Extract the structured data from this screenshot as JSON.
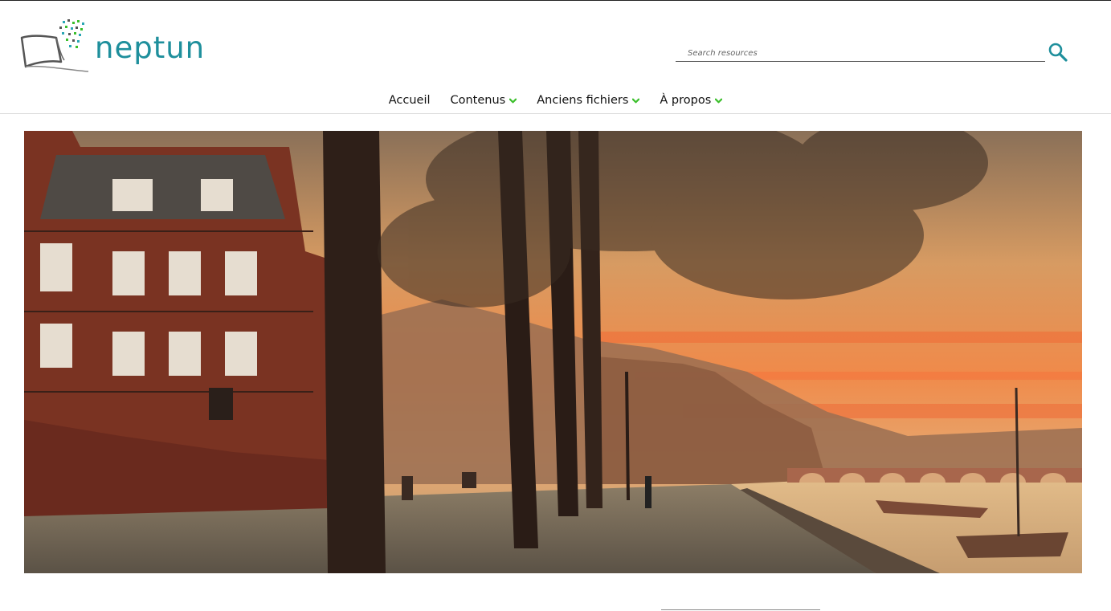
{
  "site": {
    "name": "neptun",
    "brand_color": "#1e8f9c",
    "accent_color": "#3cbf2c"
  },
  "search": {
    "placeholder": "Search resources",
    "icon": "search-icon"
  },
  "nav": {
    "items": [
      {
        "label": "Accueil",
        "has_dropdown": false
      },
      {
        "label": "Contenus",
        "has_dropdown": true
      },
      {
        "label": "Anciens fichiers",
        "has_dropdown": true
      },
      {
        "label": "À propos",
        "has_dropdown": true
      }
    ]
  },
  "hero": {
    "icon": "hero-postcard-image"
  }
}
